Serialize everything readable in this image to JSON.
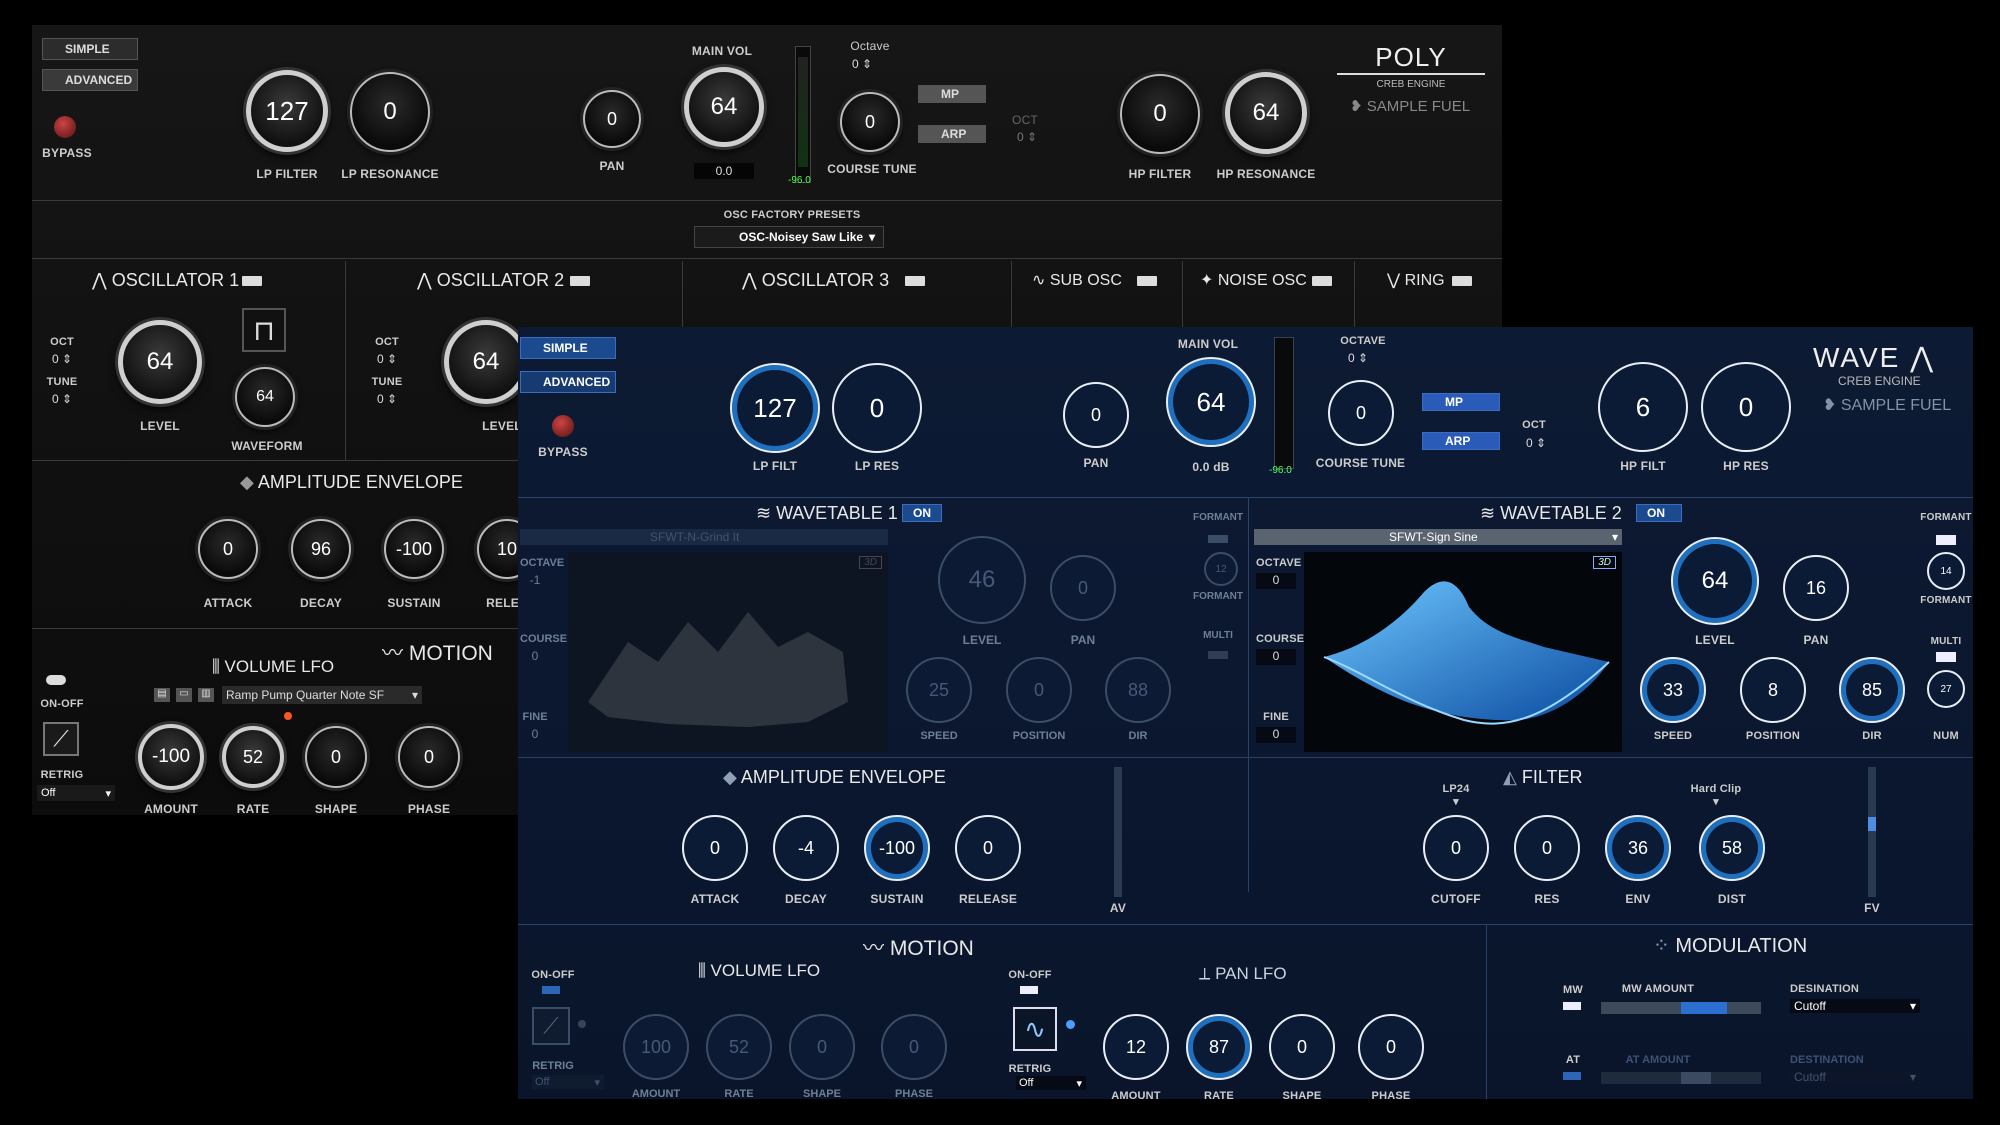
{
  "poly": {
    "simple": "SIMPLE",
    "advanced": "ADVANCED",
    "bypass": "BYPASS",
    "lp_filter": {
      "value": "127",
      "label": "LP FILTER"
    },
    "lp_resonance": {
      "value": "0",
      "label": "LP RESONANCE"
    },
    "pan": {
      "value": "0",
      "label": "PAN"
    },
    "main_vol": {
      "label": "MAIN VOL",
      "value": "64",
      "readout": "0.0",
      "meter": "-96.0"
    },
    "octave": {
      "label": "Octave",
      "value": "0"
    },
    "course_tune": {
      "value": "0",
      "label": "COURSE TUNE"
    },
    "mp": "MP",
    "arp": "ARP",
    "oct": {
      "label": "OCT",
      "value": "0"
    },
    "hp_filter": {
      "value": "0",
      "label": "HP FILTER"
    },
    "hp_resonance": {
      "value": "64",
      "label": "HP RESONANCE"
    },
    "brand": {
      "title": "POLY",
      "engine": "CREB ENGINE",
      "maker": "SAMPLE FUEL"
    },
    "osc_presets": {
      "label": "OSC FACTORY PRESETS",
      "value": "OSC-Noisey Saw Like"
    },
    "osc1": {
      "title": "OSCILLATOR 1",
      "oct_label": "OCT",
      "oct": "0",
      "tune_label": "TUNE",
      "tune": "0",
      "level": "64",
      "level_label": "LEVEL",
      "waveform": "64",
      "waveform_label": "WAVEFORM"
    },
    "osc2": {
      "title": "OSCILLATOR 2",
      "oct_label": "OCT",
      "oct": "0",
      "tune_label": "TUNE",
      "tune": "0",
      "level": "64",
      "level_label": "LEVEL"
    },
    "osc3": {
      "title": "OSCILLATOR 3"
    },
    "sub_osc": "SUB OSC",
    "noise_osc": "NOISE OSC",
    "ring": "RING",
    "amp_env": {
      "title": "AMPLITUDE ENVELOPE",
      "attack": "0",
      "attack_label": "ATTACK",
      "decay": "96",
      "decay_label": "DECAY",
      "sustain": "-100",
      "sustain_label": "SUSTAIN",
      "release": "10",
      "release_label": "RELEA"
    },
    "motion": "MOTION",
    "vol_lfo": {
      "title": "VOLUME LFO",
      "preset": "Ramp Pump Quarter Note SF",
      "onoff": "ON-OFF",
      "retrig": "RETRIG",
      "retrig_value": "Off",
      "amount": "-100",
      "amount_label": "AMOUNT",
      "rate": "52",
      "rate_label": "RATE",
      "shape": "0",
      "shape_label": "SHAPE",
      "phase": "0",
      "phase_label": "PHASE"
    }
  },
  "wave": {
    "simple": "SIMPLE",
    "advanced": "ADVANCED",
    "bypass": "BYPASS",
    "lp_filt": {
      "value": "127",
      "label": "LP FILT"
    },
    "lp_res": {
      "value": "0",
      "label": "LP RES"
    },
    "pan": {
      "value": "0",
      "label": "PAN"
    },
    "main_vol": {
      "label": "MAIN VOL",
      "value": "64",
      "readout": "0.0 dB",
      "meter": "-96.0"
    },
    "octave": {
      "label": "OCTAVE",
      "value": "0"
    },
    "course_tune": {
      "value": "0",
      "label": "COURSE TUNE"
    },
    "mp": "MP",
    "arp": "ARP",
    "oct": {
      "label": "OCT",
      "value": "0"
    },
    "hp_filt": {
      "value": "6",
      "label": "HP FILT"
    },
    "hp_res": {
      "value": "0",
      "label": "HP RES"
    },
    "brand": {
      "title": "WAVE",
      "engine": "CREB ENGINE",
      "maker": "SAMPLE FUEL"
    },
    "wt1": {
      "title": "WAVETABLE 1",
      "on": "ON",
      "preset": "SFWT-N-Grind It",
      "octave_label": "OCTAVE",
      "octave": "-1",
      "course_label": "COURSE",
      "course": "0",
      "fine_label": "FINE",
      "fine": "0",
      "badge": "3D",
      "level": "46",
      "level_label": "LEVEL",
      "pan": "0",
      "pan_label": "PAN",
      "formant_label": "FORMANT",
      "formant": "12",
      "formant2": "FORMANT",
      "multi": "MULTI",
      "speed": "25",
      "speed_label": "SPEED",
      "position": "0",
      "position_label": "POSITION",
      "dir": "88",
      "dir_label": "DIR"
    },
    "wt2": {
      "title": "WAVETABLE 2",
      "on": "ON",
      "preset": "SFWT-Sign Sine",
      "octave_label": "OCTAVE",
      "octave": "0",
      "course_label": "COURSE",
      "course": "0",
      "fine_label": "FINE",
      "fine": "0",
      "badge": "3D",
      "level": "64",
      "level_label": "LEVEL",
      "pan": "16",
      "pan_label": "PAN",
      "formant_label": "FORMANT",
      "formant": "14",
      "formant2": "FORMANT",
      "multi": "MULTI",
      "num": "27",
      "num_label": "NUM",
      "speed": "33",
      "speed_label": "SPEED",
      "position": "8",
      "position_label": "POSITION",
      "dir": "85",
      "dir_label": "DIR"
    },
    "amp_env": {
      "title": "AMPLITUDE ENVELOPE",
      "attack": "0",
      "attack_label": "ATTACK",
      "decay": "-4",
      "decay_label": "DECAY",
      "sustain": "-100",
      "sustain_label": "SUSTAIN",
      "release": "0",
      "release_label": "RELEASE",
      "av": "AV"
    },
    "filter": {
      "title": "FILTER",
      "type": "LP24",
      "clip": "Hard Clip",
      "cutoff": "0",
      "cutoff_label": "CUTOFF",
      "res": "0",
      "res_label": "RES",
      "env": "36",
      "env_label": "ENV",
      "dist": "58",
      "dist_label": "DIST",
      "fv": "FV"
    },
    "motion": "MOTION",
    "vol_lfo": {
      "title": "VOLUME LFO",
      "onoff": "ON-OFF",
      "retrig": "RETRIG",
      "retrig_value": "Off",
      "amount": "100",
      "amount_label": "AMOUNT",
      "rate": "52",
      "rate_label": "RATE",
      "shape": "0",
      "shape_label": "SHAPE",
      "phase": "0",
      "phase_label": "PHASE"
    },
    "pan_lfo": {
      "title": "PAN LFO",
      "onoff": "ON-OFF",
      "retrig": "RETRIG",
      "retrig_value": "Off",
      "amount": "12",
      "amount_label": "AMOUNT",
      "rate": "87",
      "rate_label": "RATE",
      "shape": "0",
      "shape_label": "SHAPE",
      "phase": "0",
      "phase_label": "PHASE"
    },
    "modulation": {
      "title": "MODULATION",
      "mw": "MW",
      "mw_amount": "MW AMOUNT",
      "destination": "DESINATION",
      "dest_value": "Cutoff",
      "at": "AT",
      "at_amount": "AT AMOUNT",
      "destination2": "DESTINATION",
      "dest2_value": "Cutoff"
    }
  },
  "colors": {
    "accent": "#1f6fbf",
    "poly_bg": "#111111",
    "wave_bg": "#0d1a33"
  }
}
